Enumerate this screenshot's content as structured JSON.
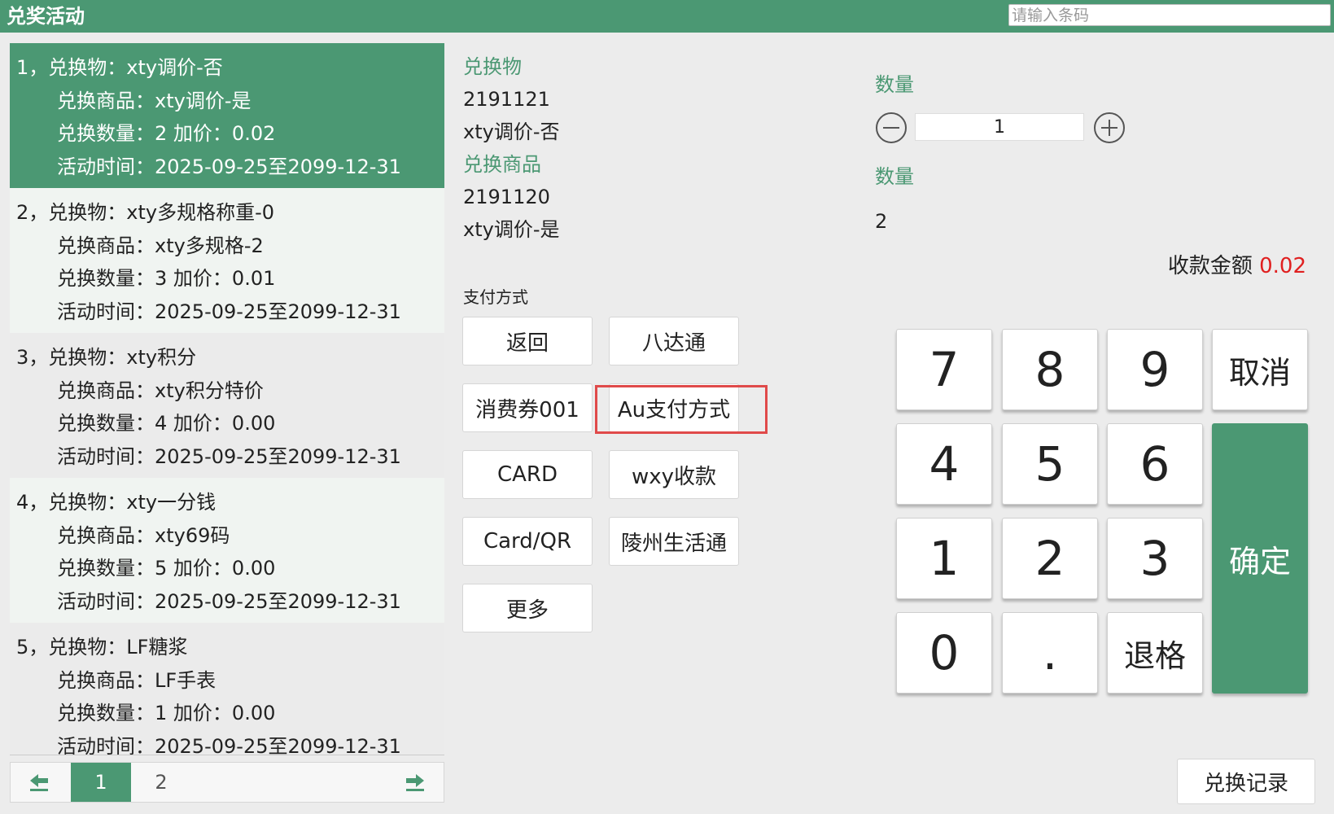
{
  "header": {
    "title": "兑奖活动",
    "barcode_placeholder": "请输入条码",
    "barcode_value": ""
  },
  "activities": [
    {
      "index": "1，",
      "item_label": "兑换物：",
      "item": "xty调价-否",
      "goods_label": "兑换商品：",
      "goods": "xty调价-是",
      "qty_label": "兑换数量：",
      "qty": "2",
      "price_label": "加价：",
      "price": "0.02",
      "time_label": "活动时间：",
      "time": "2025-09-25至2099-12-31",
      "selected": true
    },
    {
      "index": "2，",
      "item_label": "兑换物：",
      "item": "xty多规格称重-0",
      "goods_label": "兑换商品：",
      "goods": "xty多规格-2",
      "qty_label": "兑换数量：",
      "qty": "3",
      "price_label": "加价：",
      "price": "0.01",
      "time_label": "活动时间：",
      "time": "2025-09-25至2099-12-31",
      "selected": false
    },
    {
      "index": "3，",
      "item_label": "兑换物：",
      "item": "xty积分",
      "goods_label": "兑换商品：",
      "goods": "xty积分特价",
      "qty_label": "兑换数量：",
      "qty": "4",
      "price_label": "加价：",
      "price": "0.00",
      "time_label": "活动时间：",
      "time": "2025-09-25至2099-12-31",
      "selected": false
    },
    {
      "index": "4，",
      "item_label": "兑换物：",
      "item": "xty一分钱",
      "goods_label": "兑换商品：",
      "goods": "xty69码",
      "qty_label": "兑换数量：",
      "qty": "5",
      "price_label": "加价：",
      "price": "0.00",
      "time_label": "活动时间：",
      "time": "2025-09-25至2099-12-31",
      "selected": false
    },
    {
      "index": "5，",
      "item_label": "兑换物：",
      "item": "LF糖浆",
      "goods_label": "兑换商品：",
      "goods": "LF手表",
      "qty_label": "兑换数量：",
      "qty": "1",
      "price_label": "加价：",
      "price": "0.00",
      "time_label": "活动时间：",
      "time": "2025-09-25至2099-12-31",
      "selected": false
    }
  ],
  "pager": {
    "pages": [
      "1",
      "2"
    ],
    "active": "1",
    "prev_icon": "arrow-left-icon",
    "next_icon": "arrow-right-icon"
  },
  "detail": {
    "item_label": "兑换物",
    "item_code": "2191121",
    "item_name": "xty调价-否",
    "goods_label": "兑换商品",
    "goods_code": "2191120",
    "goods_name": "xty调价-是"
  },
  "payment": {
    "label": "支付方式",
    "methods": [
      "返回",
      "八达通",
      "消费券001",
      "Au支付方式",
      "CARD",
      "wxy收款",
      "Card/QR",
      "陵州生活通",
      "更多"
    ],
    "highlighted": "Au支付方式"
  },
  "quantity": {
    "label": "数量",
    "value": "1",
    "label2": "数量",
    "value2": "2"
  },
  "total": {
    "label": "收款金额",
    "amount": "0.02"
  },
  "keypad": {
    "keys": [
      "7",
      "8",
      "9",
      "取消",
      "4",
      "5",
      "6",
      "1",
      "2",
      "3",
      "0",
      ".",
      "退格"
    ],
    "confirm": "确定"
  },
  "record_button": "兑换记录",
  "colors": {
    "accent": "#4b9873",
    "amount": "#e02020",
    "highlight": "#e04a4a"
  }
}
